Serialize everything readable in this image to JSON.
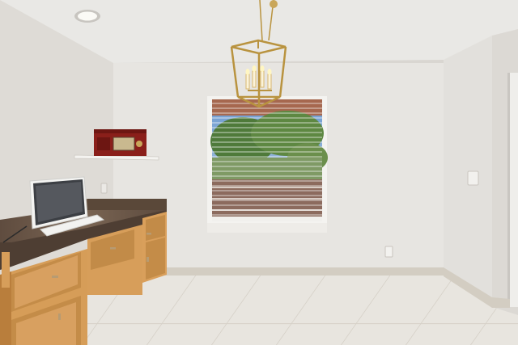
{
  "scene": {
    "kind": "interior-room-photo",
    "objects": [
      "textured-ceiling",
      "recessed-ceiling-light",
      "lantern-chandelier",
      "window-with-blinds",
      "floating-shelf",
      "red-vintage-radio",
      "computer-monitor",
      "built-in-desk",
      "granite-countertop",
      "tile-floor",
      "wall-outlet",
      "light-switch"
    ]
  },
  "colors": {
    "ceiling": "#e9e8e5",
    "wall_left": "#dedbd6",
    "wall_back": "#e7e5e1",
    "wall_right": "#e2e0dc",
    "floor": "#e8e5df",
    "baseboard": "#d3cdc2",
    "cabinet": "#d79e5a",
    "cabinet_shadow": "#b97e3c",
    "granite": "#6e5a4a",
    "chandelier_gold": "#b9933f",
    "radio_red": "#8a1f1a",
    "sky": "#8fb3d8",
    "foliage": "#4f7a3a",
    "fence": "#8c6b5e"
  }
}
